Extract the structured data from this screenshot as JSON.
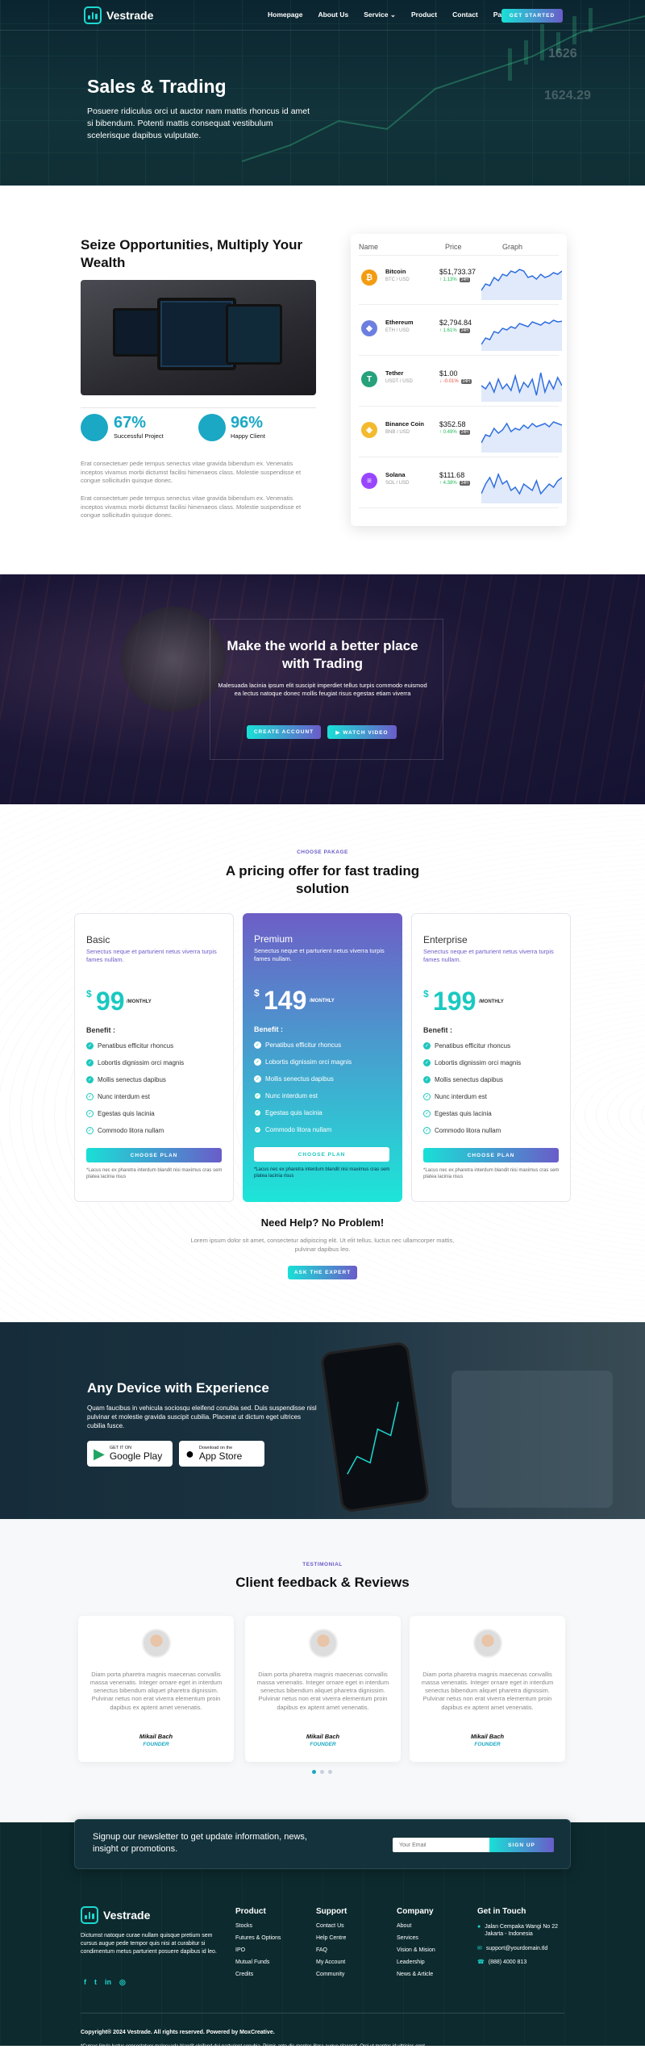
{
  "nav": {
    "brand": "Vestrade",
    "items": [
      "Homepage",
      "About Us",
      "Service",
      "Product",
      "Contact",
      "Pages"
    ],
    "cta": "GET STARTED"
  },
  "hero": {
    "title": "Sales & Trading",
    "text": "Posuere ridiculus orci ut auctor nam mattis rhoncus id amet si bibendum. Potenti mattis consequat vestibulum scelerisque dapibus vulputate.",
    "bg_numbers": [
      "1626",
      "1624.29"
    ]
  },
  "seize": {
    "title": "Seize Opportunities, Multiply Your Wealth",
    "stats": [
      {
        "value": "67%",
        "label": "Successful Project"
      },
      {
        "value": "96%",
        "label": "Happy Client"
      }
    ],
    "para1": "Erat consectetuer pede tempus senectus vitae gravida bibendum ex. Venenatis inceptos vivamus morbi dictumst facilisi himenaeos class. Molestie suspendisse et congue sollicitudin quisque donec.",
    "para2": "Erat consectetuer pede tempus senectus vitae gravida bibendum ex. Venenatis inceptos vivamus morbi dictumst facilisi himenaeos class. Molestie suspendisse et congue sollicitudin quisque donec."
  },
  "market": {
    "headers": [
      "Name",
      "Price",
      "Graph"
    ],
    "rows": [
      {
        "name": "Bitcoin",
        "pair": "BTC / USD",
        "price": "$51,733.37",
        "change": "1.13%",
        "dir": "up",
        "badge": "24H",
        "color": "#f39c12",
        "sym": "₿"
      },
      {
        "name": "Ethereum",
        "pair": "ETH / USD",
        "price": "$2,794.84",
        "change": "1.61%",
        "dir": "up",
        "badge": "24H",
        "color": "#6c7fe0",
        "sym": "◆"
      },
      {
        "name": "Tether",
        "pair": "USDT / USD",
        "price": "$1.00",
        "change": "-0.01%",
        "dir": "down",
        "badge": "24H",
        "color": "#26a17b",
        "sym": "T"
      },
      {
        "name": "Binance Coin",
        "pair": "BNB / USD",
        "price": "$352.58",
        "change": "0.49%",
        "dir": "up",
        "badge": "24H",
        "color": "#f3ba2f",
        "sym": "◈"
      },
      {
        "name": "Solana",
        "pair": "SOL / USD",
        "price": "$111.68",
        "change": "4.38%",
        "dir": "up",
        "badge": "24H",
        "color": "#9945ff",
        "sym": "≡"
      }
    ]
  },
  "world": {
    "title": "Make the world a better place with Trading",
    "text": "Malesuada lacinia ipsum elit suscipit imperdiet tellus turpis commodo euismod ea lectus natoque donec mollis feugiat risus egestas etiam viverra",
    "btn1": "CREATE ACCOUNT",
    "btn2": "WATCH VIDEO"
  },
  "pricing": {
    "eyebrow": "CHOOSE PAKAGE",
    "title": "A pricing offer for fast trading solution",
    "plans": [
      {
        "name": "Basic",
        "desc": "Senectus neque et parturient netus viverra turpis fames nullam.",
        "price": "99",
        "period": "/MONTHLY",
        "benefit": "Benefit :",
        "features": [
          "Penatibus efficitur rhoncus",
          "Lobortis dignissim orci magnis",
          "Mollis senectus dapibus",
          "Nunc interdum est",
          "Egestas quis lacinia",
          "Commodo litora nullam"
        ],
        "btn": "CHOOSE PLAN",
        "note": "*Lacus nec ex pharetra interdum blandit nisi maximus cras sem platea lacinia risus"
      },
      {
        "name": "Premium",
        "desc": "Senectus neque et parturient netus viverra turpis fames nullam.",
        "price": "149",
        "period": "/MONTHLY",
        "benefit": "Benefit :",
        "features": [
          "Penatibus efficitur rhoncus",
          "Lobortis dignissim orci magnis",
          "Mollis senectus dapibus",
          "Nunc interdum est",
          "Egestas quis lacinia",
          "Commodo litora nullam"
        ],
        "btn": "CHOOSE PLAN",
        "note": "*Lacus nec ex pharetra interdum blandit nisi maximus cras sem platea lacinia risus"
      },
      {
        "name": "Enterprise",
        "desc": "Senectus neque et parturient netus viverra turpis fames nullam.",
        "price": "199",
        "period": "/MONTHLY",
        "benefit": "Benefit :",
        "features": [
          "Penatibus efficitur rhoncus",
          "Lobortis dignissim orci magnis",
          "Mollis senectus dapibus",
          "Nunc interdum est",
          "Egestas quis lacinia",
          "Commodo litora nullam"
        ],
        "btn": "CHOOSE PLAN",
        "note": "*Lacus nec ex pharetra interdum blandit nisi maximus cras sem platea lacinia risus"
      }
    ],
    "help_title": "Need Help? No Problem!",
    "help_text": "Lorem ipsum dolor sit amet, consectetur adipiscing elit. Ut elit tellus, luctus nec ullamcorper mattis, pulvinar dapibus leo.",
    "help_btn": "ASK THE EXPERT"
  },
  "device": {
    "title": "Any Device with Experience",
    "text": "Quam faucibus in vehicula sociosqu eleifend conubia sed. Duis suspendisse nisl pulvinar et molestie gravida suscipit cubilia. Placerat ut dictum eget ultrices cubilia fusce.",
    "gplay_small": "GET IT ON",
    "gplay": "Google Play",
    "appstore_small": "Download on the",
    "appstore": "App Store"
  },
  "reviews": {
    "eyebrow": "TESTIMONIAL",
    "title": "Client feedback & Reviews",
    "items": [
      {
        "text": "Diam porta pharetra magnis maecenas convallis massa venenatis. Integer ornare eget in interdum senectus bibendum aliquet pharetra dignissim. Pulvinar netus non erat viverra elementum proin dapibus ex aptent amet venenatis.",
        "name": "Mikail Bach",
        "role": "FOUNDER"
      },
      {
        "text": "Diam porta pharetra magnis maecenas convallis massa venenatis. Integer ornare eget in interdum senectus bibendum aliquet pharetra dignissim. Pulvinar netus non erat viverra elementum proin dapibus ex aptent amet venenatis.",
        "name": "Mikail Bach",
        "role": "FOUNDER"
      },
      {
        "text": "Diam porta pharetra magnis maecenas convallis massa venenatis. Integer ornare eget in interdum senectus bibendum aliquet pharetra dignissim. Pulvinar netus non erat viverra elementum proin dapibus ex aptent amet venenatis.",
        "name": "Mikail Bach",
        "role": "FOUNDER"
      }
    ]
  },
  "newsletter": {
    "text": "Signup our newsletter to get update information, news, insight or promotions.",
    "placeholder": "Your Email",
    "btn": "SIGN UP"
  },
  "footer": {
    "brand": "Vestrade",
    "about": "Dictumst natoque curae nullam quisque pretium sem cursus augue pede tempor quis nisi at curabitur si condimentum metus parturient posuere dapibus id leo.",
    "product": {
      "title": "Product",
      "items": [
        "Stocks",
        "Futures & Options",
        "IPO",
        "Mutual Funds",
        "Credits"
      ]
    },
    "support": {
      "title": "Support",
      "items": [
        "Contact Us",
        "Help Centre",
        "FAQ",
        "My Account",
        "Community"
      ]
    },
    "company": {
      "title": "Company",
      "items": [
        "About",
        "Services",
        "Vision & Mision",
        "Leadership",
        "News & Article"
      ]
    },
    "contact": {
      "title": "Get in Touch",
      "address": "Jalan Cempaka Wangi No 22 Jakarta - Indonesia",
      "email": "support@yourdomain.tld",
      "phone": "(888) 4000 813"
    },
    "copyright": "Copyright® 2024 Vestrade. All rights reserved. Powered by MoxCreative.",
    "disclaimer": "*Cursus ligula luctus consectetuer malesuada blandit eleifend dui parturient conubia. Primis ante dis montes litora augue placerat. Orci ut montes id ultricies eget lectus proin elit vel malesuada primis."
  }
}
